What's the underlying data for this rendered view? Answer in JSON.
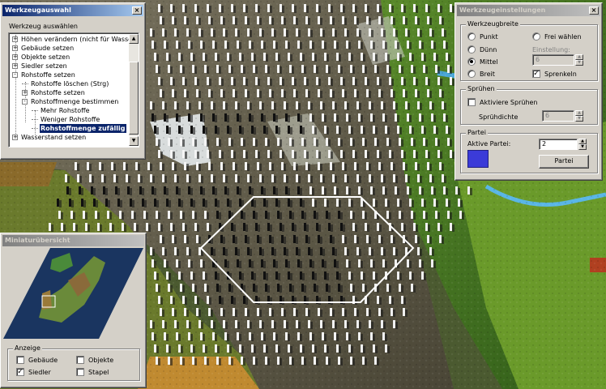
{
  "tool_window": {
    "title": "Werkzeugauswahl",
    "group_label": "Werkzeug auswählen",
    "tree": [
      {
        "label": "Höhen verändern (nicht für Wasser)",
        "expander": "+"
      },
      {
        "label": "Gebäude setzen",
        "expander": "+"
      },
      {
        "label": "Objekte setzen",
        "expander": "+"
      },
      {
        "label": "Siedler setzen",
        "expander": "+"
      },
      {
        "label": "Rohstoffe setzen",
        "expander": "-"
      },
      {
        "label": "Rohstoffe löschen (Strg)",
        "expander": ""
      },
      {
        "label": "Rohstoffe setzen",
        "expander": "+"
      },
      {
        "label": "Rohstoffmenge bestimmen",
        "expander": "-"
      },
      {
        "label": "Mehr Rohstoffe",
        "expander": ""
      },
      {
        "label": "Weniger Rohstoffe",
        "expander": ""
      },
      {
        "label": "Rohstoffmenge zufällig",
        "expander": "",
        "selected": true
      },
      {
        "label": "Wasserstand setzen",
        "expander": "+"
      }
    ]
  },
  "settings_window": {
    "title": "Werkzeugeinstellungen",
    "width_group": {
      "label": "Werkzeugbreite",
      "options": [
        "Punkt",
        "Dünn",
        "Mittel",
        "Breit"
      ],
      "selected": "Mittel",
      "free_option": "Frei wählen",
      "setting_label": "Einstellung:",
      "setting_value": "6",
      "sprinkle_label": "Sprenkeln",
      "sprinkle_checked": true
    },
    "spray_group": {
      "label": "Sprühen",
      "activate_label": "Aktiviere Sprühen",
      "activate_checked": false,
      "density_label": "Sprühdichte",
      "density_value": "6"
    },
    "party_group": {
      "label": "Partei",
      "active_label": "Aktive Partei:",
      "active_value": "2",
      "button_label": "Partei",
      "color": "#3b3bd8"
    }
  },
  "minimap_window": {
    "title": "Miniaturübersicht",
    "display_group": {
      "label": "Anzeige",
      "items": [
        {
          "label": "Gebäude",
          "checked": false
        },
        {
          "label": "Objekte",
          "checked": false
        },
        {
          "label": "Siedler",
          "checked": true
        },
        {
          "label": "Stapel",
          "checked": false
        }
      ]
    }
  },
  "colors": {
    "titlebar_active": "#0a246a",
    "titlebar_inactive": "#808080",
    "selection": "#0a246a",
    "party_swatch": "#3b3bd8",
    "cursor_outline": "#ffffff"
  }
}
